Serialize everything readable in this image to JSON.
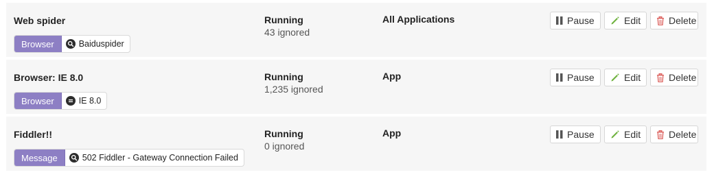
{
  "colors": {
    "row_background": "#f6f6f6",
    "filter_type_background": "#8d7fc4",
    "edit_icon": "#6fb23f",
    "delete_icon": "#d9534f"
  },
  "rules": [
    {
      "title": "Web spider",
      "status": "Running",
      "ignored": "43 ignored",
      "application": "All Applications",
      "filter": {
        "type": "Browser",
        "operator_icon": "search-icon",
        "value": "Baiduspider"
      },
      "actions": {
        "pause": "Pause",
        "edit": "Edit",
        "delete": "Delete"
      }
    },
    {
      "title": "Browser: IE 8.0",
      "status": "Running",
      "ignored": "1,235 ignored",
      "application": "App",
      "filter": {
        "type": "Browser",
        "operator_icon": "equals-icon",
        "value": "IE 8.0"
      },
      "actions": {
        "pause": "Pause",
        "edit": "Edit",
        "delete": "Delete"
      }
    },
    {
      "title": "Fiddler!!",
      "status": "Running",
      "ignored": "0 ignored",
      "application": "App",
      "filter": {
        "type": "Message",
        "operator_icon": "search-icon",
        "value": "502 Fiddler - Gateway Connection Failed"
      },
      "actions": {
        "pause": "Pause",
        "edit": "Edit",
        "delete": "Delete"
      }
    }
  ]
}
